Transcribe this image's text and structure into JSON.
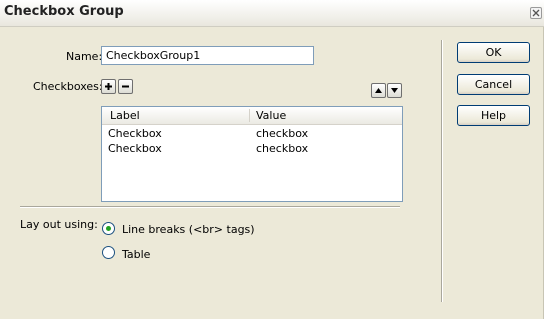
{
  "window": {
    "title": "Checkbox Group"
  },
  "form": {
    "name_label": "Name:",
    "name_value": "CheckboxGroup1",
    "checkboxes_label": "Checkboxes:"
  },
  "list": {
    "columns": [
      "Label",
      "Value"
    ],
    "rows": [
      [
        "Checkbox",
        "checkbox"
      ],
      [
        "Checkbox",
        "checkbox"
      ]
    ]
  },
  "layout": {
    "label": "Lay out using:",
    "options": [
      "Line breaks (<br> tags)",
      "Table"
    ],
    "selected_index": 0
  },
  "buttons": {
    "ok": "OK",
    "cancel": "Cancel",
    "help": "Help"
  }
}
